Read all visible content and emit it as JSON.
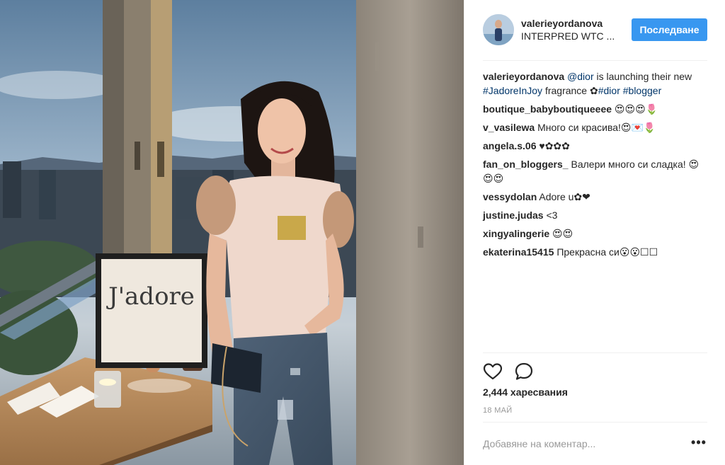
{
  "post": {
    "username": "valerieyordanova",
    "location": "INTERPRED WTC ...",
    "follow_label": "Последване",
    "photo_sign_text": "J'adore",
    "likes": "2,444 харесвания",
    "date": "18 МАЙ",
    "comment_placeholder": "Добавяне на коментар...",
    "more_label": "•••"
  },
  "caption": {
    "user": "valerieyordanova",
    "parts": [
      {
        "text": " ",
        "link": false
      },
      {
        "text": "@dior",
        "link": true
      },
      {
        "text": " is launching their new ",
        "link": false
      },
      {
        "text": "#JadoreInJoy",
        "link": true
      },
      {
        "text": " fragrance ✿",
        "link": false
      },
      {
        "text": "#dior",
        "link": true
      },
      {
        "text": " ",
        "link": false
      },
      {
        "text": "#blogger",
        "link": true
      }
    ]
  },
  "comments": [
    {
      "user": "boutique_babyboutiqueeee",
      "text": "😍😍😍🌷"
    },
    {
      "user": "v_vasilewa",
      "text": "Много си красива!😍💌🌷"
    },
    {
      "user": "angela.s.06",
      "text": "♥✿✿✿"
    },
    {
      "user": "fan_on_bloggers_",
      "text": "Валери много си сладка! 😍😍😍"
    },
    {
      "user": "vessydolan",
      "text": "Adore u✿❤"
    },
    {
      "user": "justine.judas",
      "text": "<3"
    },
    {
      "user": "xingyalingerie",
      "text": "😍😍"
    },
    {
      "user": "ekaterina15415",
      "text": "Прекрасна си😮😮☐☐"
    }
  ],
  "icons": {
    "heart": "heart-icon",
    "comment": "comment-bubble-icon",
    "more": "more-options-icon"
  },
  "colors": {
    "accent": "#3897f0",
    "link": "#003569",
    "muted": "#999999",
    "border": "#efefef"
  }
}
